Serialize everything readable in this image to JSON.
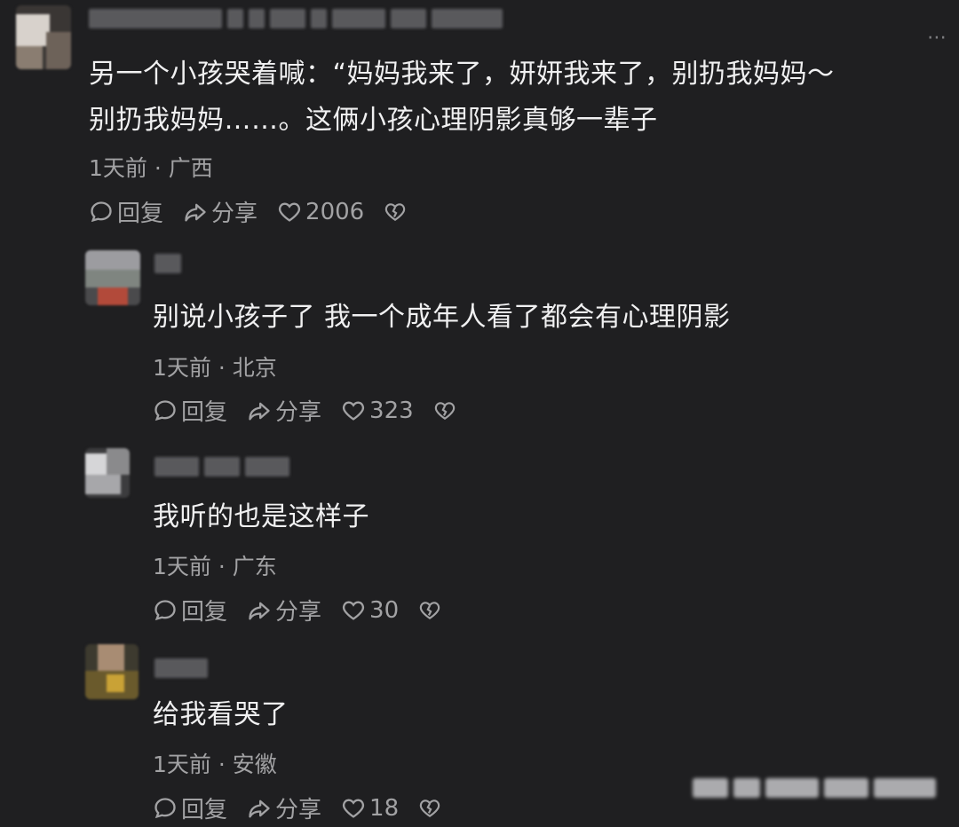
{
  "comments": [
    {
      "content": "另一个小孩哭着喊：“妈妈我来了，妍妍我来了，别扔我妈妈～\n别扔我妈妈……。这俩小孩心理阴影真够一辈子",
      "meta": "1天前 · 广西",
      "reply_label": "回复",
      "share_label": "分享",
      "likes": "2006"
    },
    {
      "content": "别说小孩子了 我一个成年人看了都会有心理阴影",
      "meta": "1天前 · 北京",
      "reply_label": "回复",
      "share_label": "分享",
      "likes": "323"
    },
    {
      "content": "我听的也是这样子",
      "meta": "1天前 · 广东",
      "reply_label": "回复",
      "share_label": "分享",
      "likes": "30"
    },
    {
      "content": "给我看哭了",
      "meta": "1天前 · 安徽",
      "reply_label": "回复",
      "share_label": "分享",
      "likes": "18"
    }
  ],
  "icons": {
    "reply": "speech-bubble-icon",
    "share": "share-arrow-icon",
    "like": "heart-icon",
    "dislike": "broken-heart-icon",
    "more": "more-dots-icon"
  },
  "colors": {
    "background": "#1f1f21",
    "text": "#f0f0f1",
    "meta": "#a2a2a4"
  }
}
